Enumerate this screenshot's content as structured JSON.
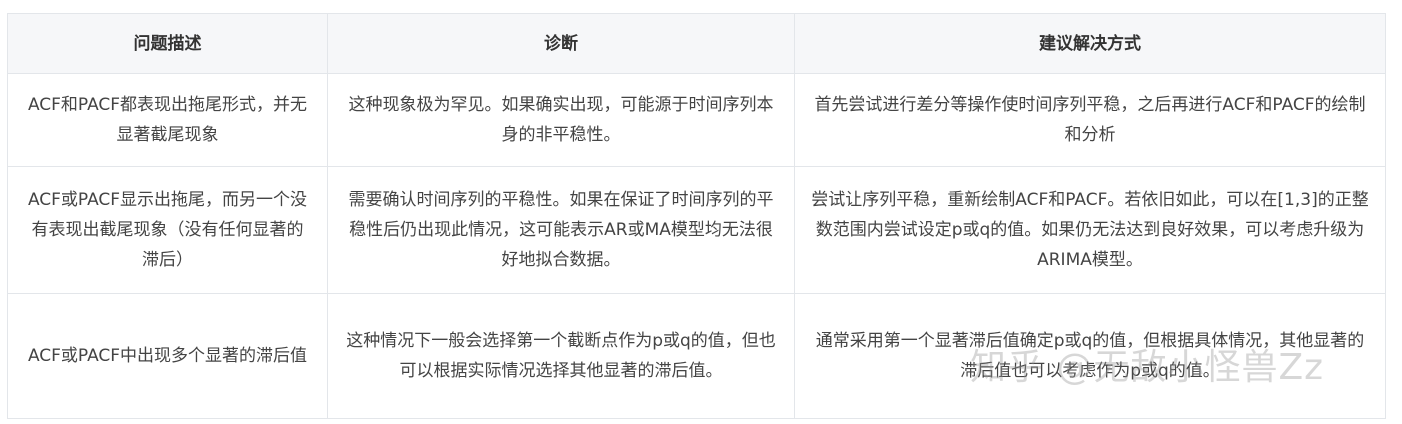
{
  "table": {
    "headers": [
      "问题描述",
      "诊断",
      "建议解决方式"
    ],
    "rows": [
      {
        "problem": "ACF和PACF都表现出拖尾形式，并无显著截尾现象",
        "diagnosis": "这种现象极为罕见。如果确实出现，可能源于时间序列本身的非平稳性。",
        "solution": "首先尝试进行差分等操作使时间序列平稳，之后再进行ACF和PACF的绘制和分析"
      },
      {
        "problem": "ACF或PACF显示出拖尾，而另一个没有表现出截尾现象（没有任何显著的滞后）",
        "diagnosis": "需要确认时间序列的平稳性。如果在保证了时间序列的平稳性后仍出现此情况，这可能表示AR或MA模型均无法很好地拟合数据。",
        "solution": "尝试让序列平稳，重新绘制ACF和PACF。若依旧如此，可以在[1,3]的正整数范围内尝试设定p或q的值。如果仍无法达到良好效果，可以考虑升级为ARIMA模型。"
      },
      {
        "problem": "ACF或PACF中出现多个显著的滞后值",
        "diagnosis": "这种情况下一般会选择第一个截断点作为p或q的值，但也可以根据实际情况选择其他显著的滞后值。",
        "solution": "通常采用第一个显著滞后值确定p或q的值，但根据具体情况，其他显著的滞后值也可以考虑作为p或q的值。"
      }
    ]
  },
  "watermark": "知乎 @无敌小怪兽Zz"
}
